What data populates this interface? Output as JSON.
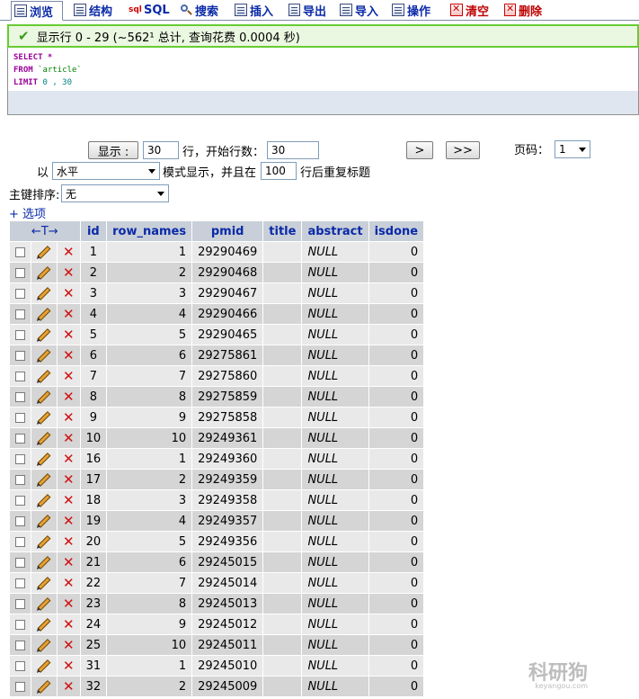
{
  "tabs": [
    {
      "label": "浏览",
      "icon": "browse-icon",
      "active": true,
      "red": false
    },
    {
      "label": "结构",
      "icon": "structure-icon",
      "active": false,
      "red": false
    },
    {
      "label": "SQL",
      "icon": "sql-icon",
      "active": false,
      "red": false
    },
    {
      "label": "搜索",
      "icon": "search-icon",
      "active": false,
      "red": false
    },
    {
      "label": "插入",
      "icon": "insert-icon",
      "active": false,
      "red": false
    },
    {
      "label": "导出",
      "icon": "export-icon",
      "active": false,
      "red": false
    },
    {
      "label": "导入",
      "icon": "import-icon",
      "active": false,
      "red": false
    },
    {
      "label": "操作",
      "icon": "operations-icon",
      "active": false,
      "red": false
    },
    {
      "label": "清空",
      "icon": "empty-icon",
      "active": false,
      "red": true
    },
    {
      "label": "删除",
      "icon": "drop-icon",
      "active": false,
      "red": true
    }
  ],
  "status": {
    "message": "显示行 0 - 29 (~562¹ 总计, 查询花费 0.0004 秒)"
  },
  "sql": {
    "line1_kw": "SELECT",
    "line1_rest": " *",
    "line2_kw": "FROM",
    "line2_str": " `article`",
    "line3_kw": "LIMIT",
    "line3_num": " 0 , 30"
  },
  "nav": {
    "show_button": "显示 :",
    "rows_value": "30",
    "rows_label": "行，开始行数：",
    "start_value": "30",
    "next_button": ">",
    "last_button": ">>",
    "page_label": "页码：",
    "page_value": "1",
    "mode_prefix": "以",
    "mode_value": "水平",
    "mode_label": "模式显示，并且在",
    "repeat_value": "100",
    "repeat_label": "行后重复标题",
    "sort_label": "主键排序:",
    "sort_value": "无",
    "options_link": "+ 选项"
  },
  "table": {
    "sort_arrows": "←T→",
    "columns": [
      "id",
      "row_names",
      "pmid",
      "title",
      "abstract",
      "isdone"
    ],
    "rows": [
      [
        "1",
        "1",
        "29290469",
        "",
        "NULL",
        "0"
      ],
      [
        "2",
        "2",
        "29290468",
        "",
        "NULL",
        "0"
      ],
      [
        "3",
        "3",
        "29290467",
        "",
        "NULL",
        "0"
      ],
      [
        "4",
        "4",
        "29290466",
        "",
        "NULL",
        "0"
      ],
      [
        "5",
        "5",
        "29290465",
        "",
        "NULL",
        "0"
      ],
      [
        "6",
        "6",
        "29275861",
        "",
        "NULL",
        "0"
      ],
      [
        "7",
        "7",
        "29275860",
        "",
        "NULL",
        "0"
      ],
      [
        "8",
        "8",
        "29275859",
        "",
        "NULL",
        "0"
      ],
      [
        "9",
        "9",
        "29275858",
        "",
        "NULL",
        "0"
      ],
      [
        "10",
        "10",
        "29249361",
        "",
        "NULL",
        "0"
      ],
      [
        "16",
        "1",
        "29249360",
        "",
        "NULL",
        "0"
      ],
      [
        "17",
        "2",
        "29249359",
        "",
        "NULL",
        "0"
      ],
      [
        "18",
        "3",
        "29249358",
        "",
        "NULL",
        "0"
      ],
      [
        "19",
        "4",
        "29249357",
        "",
        "NULL",
        "0"
      ],
      [
        "20",
        "5",
        "29249356",
        "",
        "NULL",
        "0"
      ],
      [
        "21",
        "6",
        "29245015",
        "",
        "NULL",
        "0"
      ],
      [
        "22",
        "7",
        "29245014",
        "",
        "NULL",
        "0"
      ],
      [
        "23",
        "8",
        "29245013",
        "",
        "NULL",
        "0"
      ],
      [
        "24",
        "9",
        "29245012",
        "",
        "NULL",
        "0"
      ],
      [
        "25",
        "10",
        "29245011",
        "",
        "NULL",
        "0"
      ],
      [
        "31",
        "1",
        "29245010",
        "",
        "NULL",
        "0"
      ],
      [
        "32",
        "2",
        "29245009",
        "",
        "NULL",
        "0"
      ]
    ]
  },
  "watermark": {
    "text": "科研狗",
    "sub": "keyangou.com"
  }
}
